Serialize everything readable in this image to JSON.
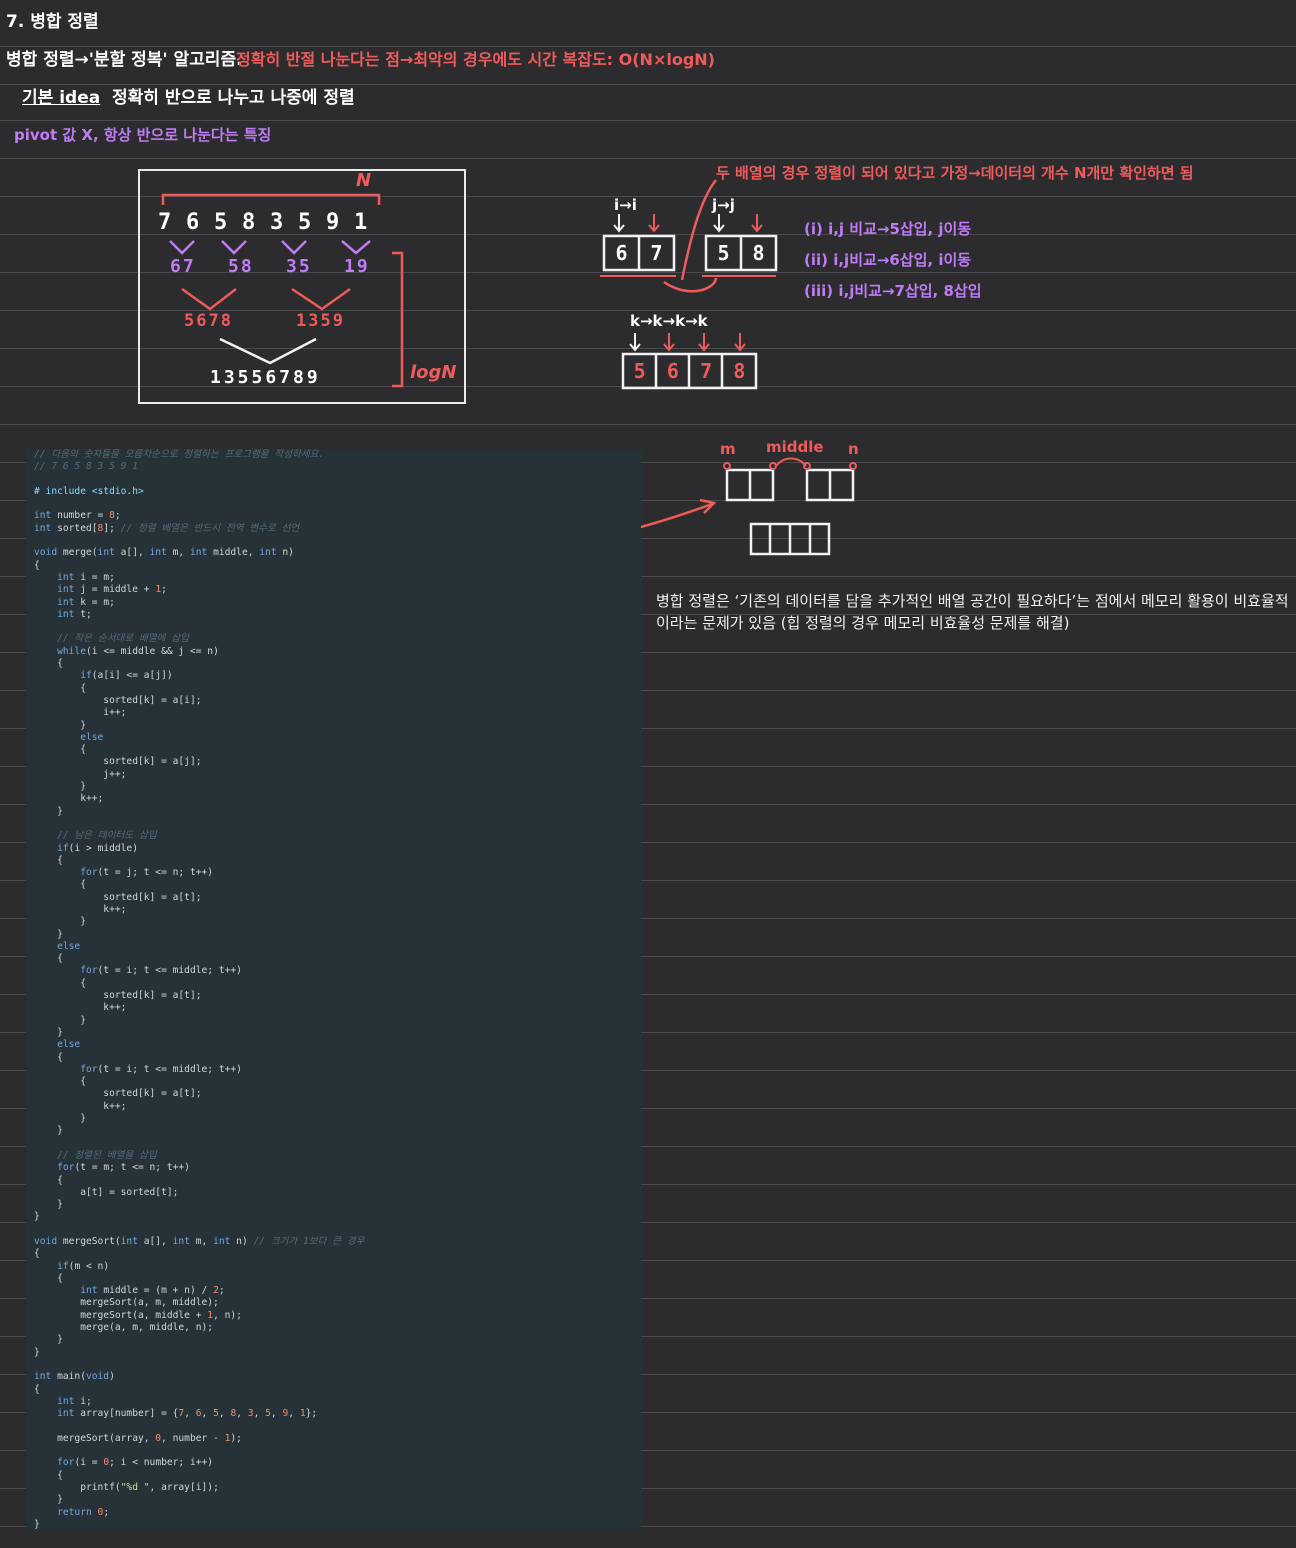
{
  "heading": {
    "number_title": "7. 병합 정렬",
    "line1_white": "병합 정렬→'분할 정복' 알고리즘.",
    "line1_red": "정확히 반절 나눈다는 점→최악의 경우에도 시간 복잡도: O(N×logN)",
    "line2_white_label": "기본 idea",
    "line2_white_text": "정확히 반으로 나누고 나중에 정렬",
    "line3_purple": "pivot 값 X, 항상 반으로 나눈다는 특징"
  },
  "tree_diagram": {
    "n_label": "N",
    "logn_label": "logN",
    "row1": [
      "7",
      "6",
      "5",
      "8",
      "3",
      "5",
      "9",
      "1"
    ],
    "row2": [
      "67",
      "58",
      "35",
      "19"
    ],
    "row3": [
      "5678",
      "1359"
    ],
    "row4": "13556789"
  },
  "merge_example": {
    "note_red": "두 배열의 경우 정렬이 되어 있다고 가정→데이터의 개수 N개만 확인하면 됨",
    "i_label": "i→i",
    "j_label": "j→j",
    "left_array": [
      "6",
      "7"
    ],
    "right_array": [
      "5",
      "8"
    ],
    "steps": [
      "(i) i,j 비교→5삽입, j이동",
      "(ii) i,j비교→6삽입, i이동",
      "(iii) i,j비교→7삽입, 8삽입"
    ],
    "k_label": "k→k→k→k",
    "merged_array": [
      "5",
      "6",
      "7",
      "8"
    ]
  },
  "middle_diagram": {
    "m_label": "m",
    "middle_label": "middle",
    "n_label": "n"
  },
  "memory_note": "병합 정렬은 ‘기존의 데이터를 담을 추가적인 배열 공간이 필요하다’는 점에서 메모리 활용이 비효율적이라는 문제가 있음 (힙 정렬의 경우 메모리 비효율성 문제를 해결)",
  "colors": {
    "background": "#2c2c2e",
    "red": "#ef5b5b",
    "purple": "#c07cf5",
    "code_bg": "#263238"
  }
}
